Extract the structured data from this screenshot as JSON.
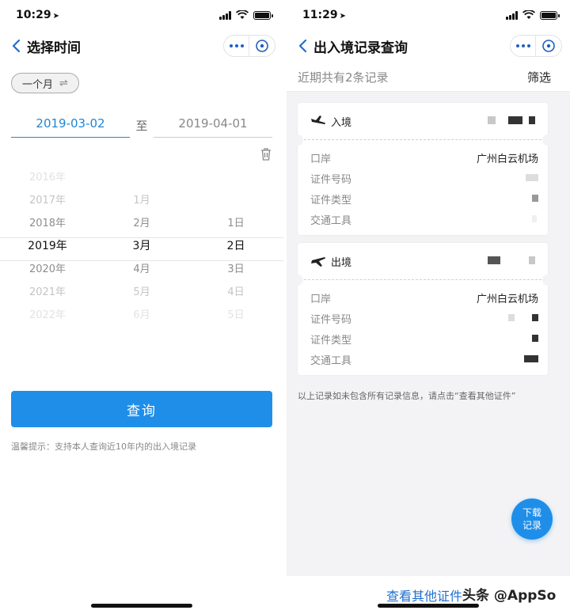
{
  "left": {
    "status": {
      "time": "10:29",
      "location_glyph": "➤"
    },
    "nav": {
      "title": "选择时间"
    },
    "period": {
      "label": "一个月",
      "swap_glyph": "⇌"
    },
    "range": {
      "start": "2019-03-02",
      "to": "至",
      "end": "2019-04-01"
    },
    "picker": {
      "years": [
        "2016年",
        "2017年",
        "2018年",
        "2019年",
        "2020年",
        "2021年",
        "2022年"
      ],
      "months": [
        "",
        "1月",
        "2月",
        "3月",
        "4月",
        "5月",
        "6月"
      ],
      "days": [
        "",
        "",
        "1日",
        "2日",
        "3日",
        "4日",
        "5日"
      ],
      "selected": {
        "year": "2019年",
        "month": "3月",
        "day": "2日"
      }
    },
    "query_button": "查询",
    "tip": "温馨提示：支持本人查询近10年内的出入境记录"
  },
  "right": {
    "status": {
      "time": "11:29",
      "location_glyph": "➤"
    },
    "nav": {
      "title": "出入境记录查询"
    },
    "summary": {
      "count_text": "近期共有2条记录",
      "filter": "筛选"
    },
    "records": [
      {
        "direction": "入境",
        "fields": [
          {
            "label": "口岸",
            "value": "广州白云机场"
          },
          {
            "label": "证件号码",
            "value": ""
          },
          {
            "label": "证件类型",
            "value": ""
          },
          {
            "label": "交通工具",
            "value": ""
          }
        ]
      },
      {
        "direction": "出境",
        "fields": [
          {
            "label": "口岸",
            "value": "广州白云机场"
          },
          {
            "label": "证件号码",
            "value": ""
          },
          {
            "label": "证件类型",
            "value": ""
          },
          {
            "label": "交通工具",
            "value": ""
          }
        ]
      }
    ],
    "note": "以上记录如未包含所有记录信息，请点击“查看其他证件”",
    "download_button": {
      "line1": "下载",
      "line2": "记录"
    },
    "other_docs_link": "查看其他证件"
  },
  "watermark": "头条 @AppSo",
  "colors": {
    "accent": "#1f8ee8",
    "link": "#1f6fcf",
    "selected_date": "#1f86d6"
  },
  "icons": [
    "back-chevron-icon",
    "more-dots-icon",
    "close-circle-icon",
    "trash-icon",
    "plane-arrival-icon",
    "plane-departure-icon",
    "signal-icon",
    "wifi-icon",
    "battery-icon"
  ]
}
